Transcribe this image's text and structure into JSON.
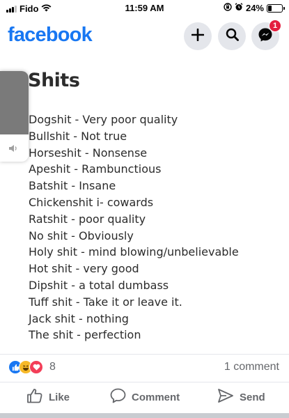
{
  "status_bar": {
    "carrier": "Fido",
    "time": "11:59 AM",
    "battery": "24%",
    "battery_level": 0.24,
    "icons": [
      "signal-icon",
      "wifi-icon",
      "orientation-lock-icon",
      "alarm-icon",
      "battery-icon"
    ]
  },
  "header": {
    "logo": "facebook",
    "buttons": [
      "add-icon",
      "search-icon",
      "messenger-icon"
    ],
    "messenger_badge": "1",
    "colors": {
      "brand": "#1877f2",
      "badge": "#e41e3f",
      "button_bg": "#e4e6eb"
    }
  },
  "post": {
    "title": "Shits",
    "items": [
      "Dogshit - Very poor quality",
      "Bullshit - Not true",
      "Horseshit - Nonsense",
      "Apeshit - Rambunctious",
      "Batshit - Insane",
      "Chickenshit i- cowards",
      "Ratshit - poor quality",
      "No shit - Obviously",
      "Holy shit - mind blowing/unbelievable",
      "Hot shit - very good",
      "Dipshit - a total dumbass",
      "Tuff shit - Take it or leave it.",
      "Jack shit - nothing",
      "The shit - perfection"
    ]
  },
  "volume_hud": {
    "level": 0.7,
    "icon": "speaker-icon"
  },
  "engagement": {
    "reactions": [
      "like-reaction-icon",
      "haha-reaction-icon",
      "love-reaction-icon"
    ],
    "reaction_count": "8",
    "comment_count": "1 comment"
  },
  "actions": {
    "like": "Like",
    "comment": "Comment",
    "send": "Send"
  }
}
